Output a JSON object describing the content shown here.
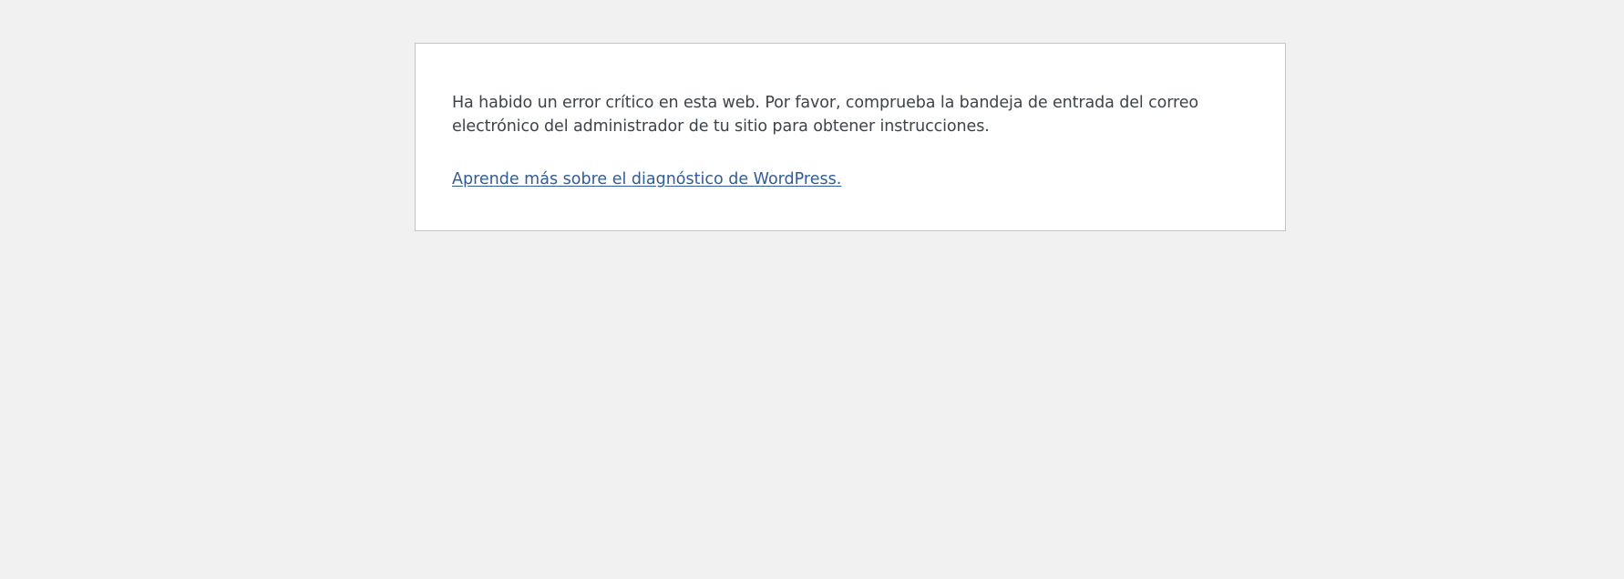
{
  "error_page": {
    "message": "Ha habido un error crítico en esta web. Por favor, comprueba la bandeja de entrada del correo electrónico del administrador de tu sitio para obtener instrucciones.",
    "learn_more_link": "Aprende más sobre el diagnóstico de WordPress."
  },
  "colors": {
    "background": "#f1f1f1",
    "panel": "#ffffff",
    "text": "#3c434a",
    "link": "#2f5c9a"
  }
}
